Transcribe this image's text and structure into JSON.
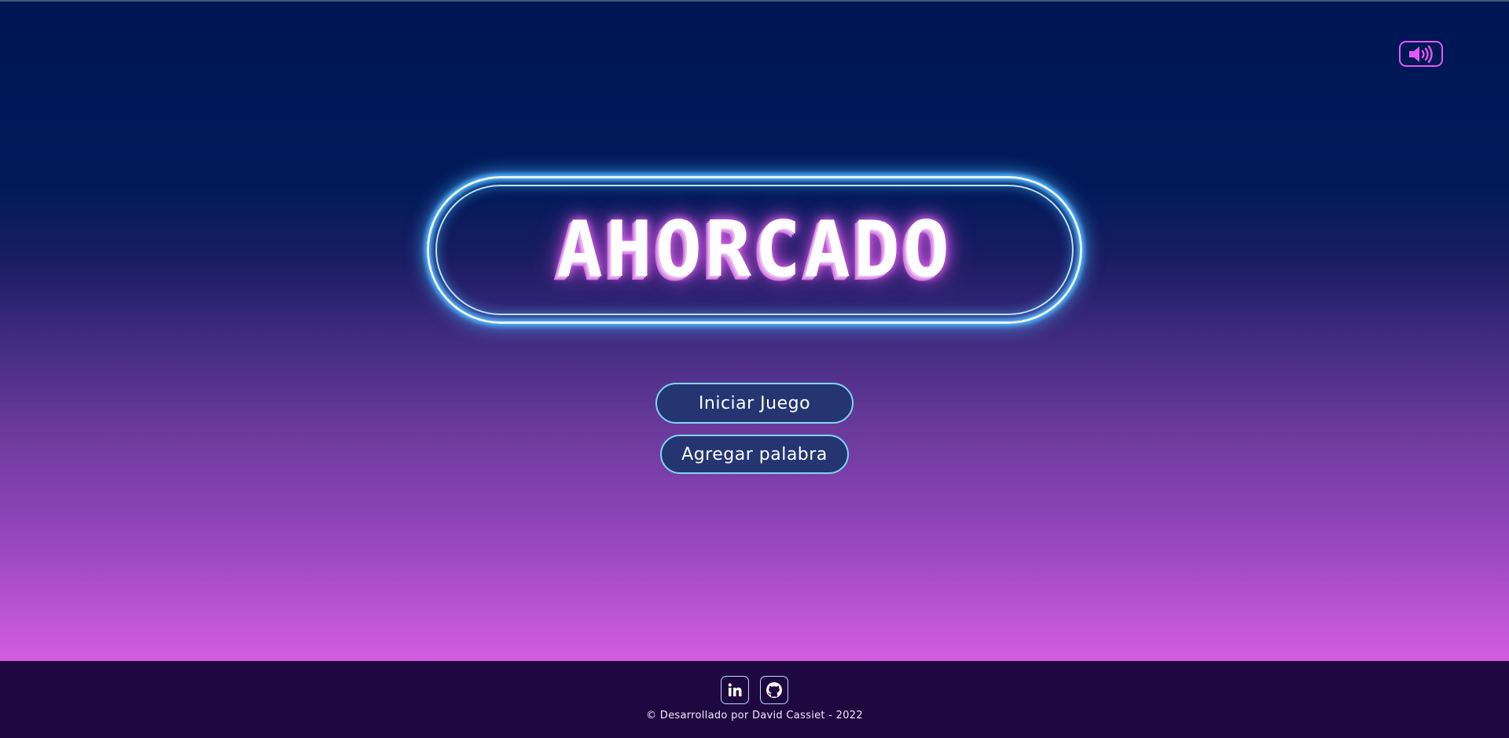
{
  "game": {
    "title": "AHORCADO"
  },
  "menu": {
    "start_label": "Iniciar Juego",
    "add_word_label": "Agregar palabra"
  },
  "sound_toggle": {
    "icon": "volume-icon"
  },
  "footer": {
    "credits": "© Desarrollado por David Cassiet - 2022",
    "social_links": [
      {
        "name": "linkedin",
        "label": "in"
      },
      {
        "name": "github",
        "label": "github-icon"
      }
    ]
  },
  "colors": {
    "accent_pink": "#e259f0",
    "accent_cyan": "#7fd6f5",
    "button_fill": "#243572",
    "footer_bg": "#1f0840"
  }
}
